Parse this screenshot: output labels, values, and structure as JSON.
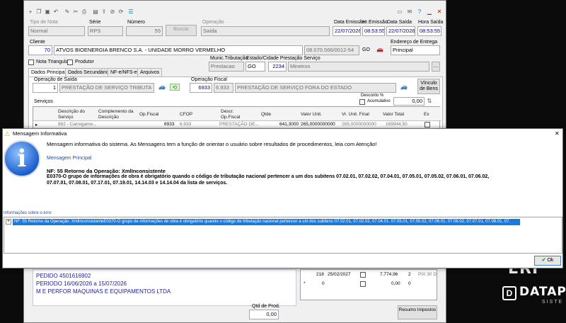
{
  "main_window": {
    "toolbar_icons": [
      "add-icon",
      "copy-icon",
      "save-icon",
      "undo-icon",
      "tool-icon",
      "tool2-icon",
      "folder-icon",
      "export-icon",
      "stop-icon",
      "refresh-icon",
      "list-icon"
    ],
    "right_icons": [
      "screen-icon",
      "mail-icon",
      "help-icon",
      "minimize-icon",
      "close-icon"
    ],
    "tipo_nota_label": "Tipo de Nota",
    "tipo_nota_value": "Normal",
    "serie_label": "Série",
    "serie_value": "RPS",
    "numero_label": "Número",
    "numero_value": "55",
    "buscar_label": "Buscar",
    "operacao_label": "Operação",
    "operacao_value": "Saída",
    "data_emissao_label": "Data Emissão",
    "data_emissao_value": "22/07/2026",
    "hr_emissao_label": "Hr.Emissão",
    "hr_emissao_value": "08:53:55",
    "data_saida_label": "Data Saída",
    "data_saida_value": "22/07/2026",
    "hora_saida_label": "Hora Saída",
    "hora_saida_value": "08:53:55",
    "cliente_label": "Cliente",
    "cliente_code": "70",
    "cliente_name": "ATVOS BIOENERGIA BRENCO S.A. - UNIDADE MORRO VERMELHO",
    "cliente_cnpj": "08.070.566/0012-54",
    "cliente_uf": "GO",
    "endereco_entrega_label": "Endereço de Entrega",
    "endereco_entrega_value": "Principal",
    "nota_triangular_label": "Nota Triangular",
    "produtor_label": "Produtor",
    "munic_tributacao_label": "Munic.Tributação",
    "munic_tributacao_value": "Prestacao",
    "estado_cidade_label": "Estado/Cidade Prestação Serviço",
    "estado_value": "GO",
    "cidade_code": "2234",
    "cidade_name": "Mineiros",
    "tabs": [
      "Dados Principais",
      "Dados Secundários",
      "NF-e/NFS-e",
      "Arquivos"
    ],
    "operacao_saida_label": "Operação de Saída",
    "operacao_saida_code": "1",
    "operacao_saida_name": "PRESTAÇÃO DE SERVIÇO TRIBUTA",
    "operacao_fiscal_label": "Operação Fiscal",
    "operacao_fiscal_code": "6933",
    "operacao_fiscal_code2": "6.933",
    "operacao_fiscal_name": "PRESTAÇÃO DE SERVIÇO FORA DO ESTADO",
    "vinculo_bens_label": "Vínculo de Bens",
    "desconto_label": "Desconto %",
    "acumulativo_label": "Acumulativo",
    "desconto_value": "0,00",
    "servicos_label": "Serviços",
    "grid_headers": [
      "Descrição do Serviço",
      "Complemento da Descrição",
      "Op.Fiscal",
      "CFOP",
      "Descr. Op.Fiscal",
      "Qtde",
      "Valor Unit.",
      "Vr. Unit. Final",
      "Valor Total",
      "Ex"
    ],
    "grid_row": [
      "882 - Carregame...",
      "",
      "6933",
      "6.933",
      "PRESTAÇÃO DE...",
      "641,3000",
      "265,0000000000",
      "265,0000000000",
      "169944,50",
      ""
    ]
  },
  "dialog": {
    "title": "Mensagem Informativa",
    "intro": "Mensagem informativa do sistema. As Mensagens tem a função de orientar o usuário sobre resultados de procedimentos, leia com Atenção!",
    "section_label": "Mensagem Principal",
    "nf_line": "NF: 55 Retorno da Operação: XmlInconsistente",
    "error_line1": "E0370-O grupo de informações de obra é obrigatório quando o código de tributação nacional pertencer a um dos subitens 07.02.01, 07.02.02, 07.04.01, 07.05.01, 07.05.02, 07.06.01, 07.06.02,",
    "error_line2": "07.07.01, 07.08.01, 07.17.01, 07.19.01, 14.14.03 e 14.14.04 da lista de serviços.",
    "info_label": "Informações sobre o erro:",
    "log_line": "NF: 55 Retorno da Operação: XmlInconsistenteE0370-O grupo de informações de obra é obrigatório quando o código de tributação nacional pertencer a um dos subitens 07.02.01, 07.02.02, 07.04.01, 07.05.01, 07.05.02, 07.06.01, 07.06.02, 07.07.01, 07.08.01, 07.",
    "ok_label": "Ok"
  },
  "lower": {
    "line1": "PEDIDO 4501616902",
    "line2": "PERIODO 16/06/2026 a 15/07/2026",
    "line3": "M E PERFOR MAQUINAS E EQUIPAMENTOS LTDA",
    "qtd_prod_label": "Qtd de Prod.",
    "qtd_prod_value": "0,00",
    "parc_row1": [
      "218",
      "25/02/2027",
      "",
      "7.774,96",
      "2",
      "PIX 30 D"
    ],
    "parc_row2": [
      "*",
      "0",
      "",
      "",
      "0,00",
      "0"
    ],
    "resumo_label": "Resumo Impostos"
  },
  "brand": {
    "partial": "ERI",
    "name": "DATAP",
    "sub": "SISTE"
  }
}
